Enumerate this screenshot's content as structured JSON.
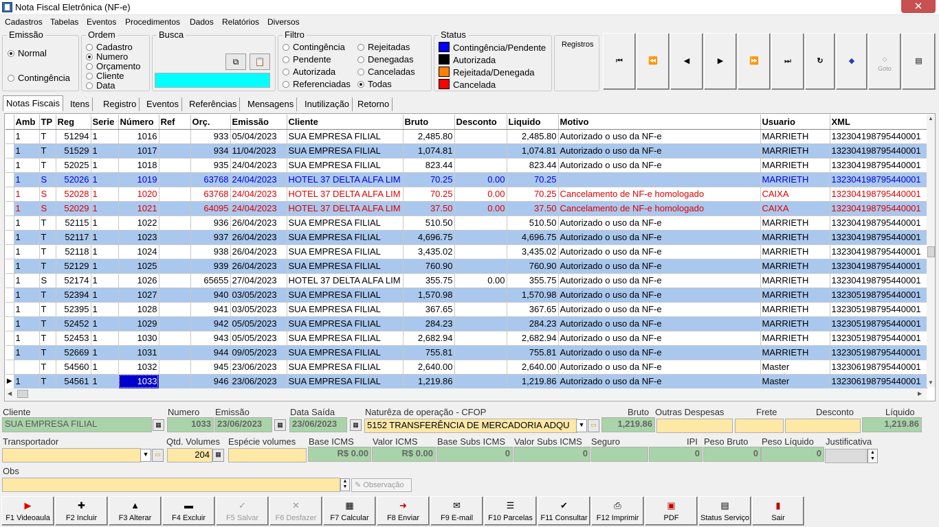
{
  "window": {
    "title": "Nota Fiscal Eletrônica (NF-e)",
    "close": "✕"
  },
  "menu": [
    "Cadastros",
    "Tabelas",
    "Eventos",
    "Procedimentos",
    "Dados",
    "Relatórios",
    "Diversos"
  ],
  "emissao": {
    "label": "Emissão",
    "options": [
      "Normal",
      "Contingência"
    ],
    "selected": "Normal"
  },
  "ordem": {
    "label": "Ordem",
    "options": [
      "Cadastro",
      "Numero",
      "Orçamento",
      "Cliente",
      "Data"
    ],
    "selected": "Numero"
  },
  "busca": {
    "label": "Busca",
    "value": ""
  },
  "filtro": {
    "label": "Filtro",
    "left": [
      "Contingência",
      "Pendente",
      "Autorizada",
      "Referenciadas"
    ],
    "right": [
      "Rejeitadas",
      "Denegadas",
      "Canceladas",
      "Todas"
    ],
    "selected": "Todas"
  },
  "status": {
    "label": "Status",
    "items": [
      {
        "label": "Contingência/Pendente",
        "color": "#0000ff"
      },
      {
        "label": "Autorizada",
        "color": "#000000"
      },
      {
        "label": "Rejeitada/Denegada",
        "color": "#ff8000"
      },
      {
        "label": "Cancelada",
        "color": "#ff0000"
      }
    ]
  },
  "registros": {
    "label": "Registros"
  },
  "nav_icons": [
    "first-icon",
    "prev-page-icon",
    "prev-icon",
    "next-icon",
    "next-page-icon",
    "last-icon",
    "refresh-icon",
    "tag-icon",
    "goto-icon",
    "grid-icon"
  ],
  "nav_goto_label": "Goto",
  "tabs": [
    "Notas Fiscais",
    "Itens",
    "Registro",
    "Eventos",
    "Referências",
    "Mensagens",
    "Inutilização",
    "Retorno"
  ],
  "grid": {
    "columns": [
      "Amb",
      "TP",
      "Reg",
      "Serie",
      "Número",
      "Ref",
      "Orç.",
      "Emissão",
      "Cliente",
      "Bruto",
      "Desconto",
      "Liquido",
      "Motivo",
      "Usuario",
      "XML"
    ],
    "rows": [
      {
        "amb": "1",
        "tp": "T",
        "reg": "51294",
        "serie": "1",
        "numero": "1016",
        "ref": "",
        "orc": "933",
        "emissao": "05/04/2023",
        "cliente": "SUA EMPRESA FILIAL",
        "bruto": "2,485.80",
        "desconto": "",
        "liquido": "2,485.80",
        "motivo": "Autorizado o uso da NF-e",
        "usuario": "MARRIETH",
        "xml": "132304198795440001",
        "style": ""
      },
      {
        "amb": "1",
        "tp": "T",
        "reg": "51529",
        "serie": "1",
        "numero": "1017",
        "ref": "",
        "orc": "934",
        "emissao": "11/04/2023",
        "cliente": "SUA EMPRESA FILIAL",
        "bruto": "1,074.81",
        "desconto": "",
        "liquido": "1,074.81",
        "motivo": "Autorizado o uso da NF-e",
        "usuario": "MARRIETH",
        "xml": "132304198795440001",
        "style": "alt"
      },
      {
        "amb": "1",
        "tp": "T",
        "reg": "52025",
        "serie": "1",
        "numero": "1018",
        "ref": "",
        "orc": "935",
        "emissao": "24/04/2023",
        "cliente": "SUA EMPRESA FILIAL",
        "bruto": "823.44",
        "desconto": "",
        "liquido": "823.44",
        "motivo": "Autorizado o uso da NF-e",
        "usuario": "MARRIETH",
        "xml": "132304198795440001",
        "style": ""
      },
      {
        "amb": "1",
        "tp": "S",
        "reg": "52026",
        "serie": "1",
        "numero": "1019",
        "ref": "",
        "orc": "63768",
        "emissao": "24/04/2023",
        "cliente": "HOTEL 37 DELTA ALFA LIM",
        "bruto": "70.25",
        "desconto": "0.00",
        "liquido": "70.25",
        "motivo": "",
        "usuario": "MARRIETH",
        "xml": "132304198795440001",
        "style": "alt blue"
      },
      {
        "amb": "1",
        "tp": "S",
        "reg": "52028",
        "serie": "1",
        "numero": "1020",
        "ref": "",
        "orc": "63768",
        "emissao": "24/04/2023",
        "cliente": "HOTEL 37 DELTA ALFA LIM",
        "bruto": "70.25",
        "desconto": "0.00",
        "liquido": "70.25",
        "motivo": "Cancelamento de NF-e homologado",
        "usuario": "CAIXA",
        "xml": "132304198795440001",
        "style": "red"
      },
      {
        "amb": "1",
        "tp": "S",
        "reg": "52029",
        "serie": "1",
        "numero": "1021",
        "ref": "",
        "orc": "64095",
        "emissao": "24/04/2023",
        "cliente": "HOTEL 37 DELTA ALFA LIM",
        "bruto": "37.50",
        "desconto": "0.00",
        "liquido": "37.50",
        "motivo": "Cancelamento de NF-e homologado",
        "usuario": "CAIXA",
        "xml": "132304198795440001",
        "style": "alt red"
      },
      {
        "amb": "1",
        "tp": "T",
        "reg": "52115",
        "serie": "1",
        "numero": "1022",
        "ref": "",
        "orc": "936",
        "emissao": "26/04/2023",
        "cliente": "SUA EMPRESA FILIAL",
        "bruto": "510.50",
        "desconto": "",
        "liquido": "510.50",
        "motivo": "Autorizado o uso da NF-e",
        "usuario": "MARRIETH",
        "xml": "132304198795440001",
        "style": ""
      },
      {
        "amb": "1",
        "tp": "T",
        "reg": "52117",
        "serie": "1",
        "numero": "1023",
        "ref": "",
        "orc": "937",
        "emissao": "26/04/2023",
        "cliente": "SUA EMPRESA FILIAL",
        "bruto": "4,696.75",
        "desconto": "",
        "liquido": "4,696.75",
        "motivo": "Autorizado o uso da NF-e",
        "usuario": "MARRIETH",
        "xml": "132304198795440001",
        "style": "alt"
      },
      {
        "amb": "1",
        "tp": "T",
        "reg": "52118",
        "serie": "1",
        "numero": "1024",
        "ref": "",
        "orc": "938",
        "emissao": "26/04/2023",
        "cliente": "SUA EMPRESA FILIAL",
        "bruto": "3,435.02",
        "desconto": "",
        "liquido": "3,435.02",
        "motivo": "Autorizado o uso da NF-e",
        "usuario": "MARRIETH",
        "xml": "132304198795440001",
        "style": ""
      },
      {
        "amb": "1",
        "tp": "T",
        "reg": "52129",
        "serie": "1",
        "numero": "1025",
        "ref": "",
        "orc": "939",
        "emissao": "26/04/2023",
        "cliente": "SUA EMPRESA FILIAL",
        "bruto": "760.90",
        "desconto": "",
        "liquido": "760.90",
        "motivo": "Autorizado o uso da NF-e",
        "usuario": "MARRIETH",
        "xml": "132304198795440001",
        "style": "alt"
      },
      {
        "amb": "1",
        "tp": "S",
        "reg": "52174",
        "serie": "1",
        "numero": "1026",
        "ref": "",
        "orc": "65655",
        "emissao": "27/04/2023",
        "cliente": "HOTEL 37 DELTA ALFA LIM",
        "bruto": "355.75",
        "desconto": "0.00",
        "liquido": "355.75",
        "motivo": "Autorizado o uso da NF-e",
        "usuario": "MARRIETH",
        "xml": "132304198795440001",
        "style": ""
      },
      {
        "amb": "1",
        "tp": "T",
        "reg": "52394",
        "serie": "1",
        "numero": "1027",
        "ref": "",
        "orc": "940",
        "emissao": "03/05/2023",
        "cliente": "SUA EMPRESA FILIAL",
        "bruto": "1,570.98",
        "desconto": "",
        "liquido": "1,570.98",
        "motivo": "Autorizado o uso da NF-e",
        "usuario": "MARRIETH",
        "xml": "132305198795440001",
        "style": "alt"
      },
      {
        "amb": "1",
        "tp": "T",
        "reg": "52395",
        "serie": "1",
        "numero": "1028",
        "ref": "",
        "orc": "941",
        "emissao": "03/05/2023",
        "cliente": "SUA EMPRESA FILIAL",
        "bruto": "367.65",
        "desconto": "",
        "liquido": "367.65",
        "motivo": "Autorizado o uso da NF-e",
        "usuario": "MARRIETH",
        "xml": "132305198795440001",
        "style": ""
      },
      {
        "amb": "1",
        "tp": "T",
        "reg": "52452",
        "serie": "1",
        "numero": "1029",
        "ref": "",
        "orc": "942",
        "emissao": "05/05/2023",
        "cliente": "SUA EMPRESA FILIAL",
        "bruto": "284.23",
        "desconto": "",
        "liquido": "284.23",
        "motivo": "Autorizado o uso da NF-e",
        "usuario": "MARRIETH",
        "xml": "132305198795440001",
        "style": "alt"
      },
      {
        "amb": "1",
        "tp": "T",
        "reg": "52453",
        "serie": "1",
        "numero": "1030",
        "ref": "",
        "orc": "943",
        "emissao": "05/05/2023",
        "cliente": "SUA EMPRESA FILIAL",
        "bruto": "2,682.94",
        "desconto": "",
        "liquido": "2,682.94",
        "motivo": "Autorizado o uso da NF-e",
        "usuario": "MARRIETH",
        "xml": "132305198795440001",
        "style": ""
      },
      {
        "amb": "1",
        "tp": "T",
        "reg": "52669",
        "serie": "1",
        "numero": "1031",
        "ref": "",
        "orc": "944",
        "emissao": "09/05/2023",
        "cliente": "SUA EMPRESA FILIAL",
        "bruto": "755.81",
        "desconto": "",
        "liquido": "755.81",
        "motivo": "Autorizado o uso da NF-e",
        "usuario": "MARRIETH",
        "xml": "132305198795440001",
        "style": "alt"
      },
      {
        "amb": "",
        "tp": "T",
        "reg": "54560",
        "serie": "1",
        "numero": "1032",
        "ref": "",
        "orc": "945",
        "emissao": "23/06/2023",
        "cliente": "SUA EMPRESA FILIAL",
        "bruto": "2,640.00",
        "desconto": "",
        "liquido": "2,640.00",
        "motivo": "Autorizado o uso da NF-e",
        "usuario": "Master",
        "xml": "132306198795440001",
        "style": ""
      },
      {
        "amb": "1",
        "tp": "T",
        "reg": "54561",
        "serie": "1",
        "numero": "1033",
        "ref": "",
        "orc": "946",
        "emissao": "23/06/2023",
        "cliente": "SUA EMPRESA FILIAL",
        "bruto": "1,219.86",
        "desconto": "",
        "liquido": "1,219.86",
        "motivo": "Autorizado o uso da NF-e",
        "usuario": "Master",
        "xml": "132306198795440001",
        "style": "alt current"
      }
    ]
  },
  "detail": {
    "cliente_label": "Cliente",
    "cliente": "SUA EMPRESA FILIAL",
    "numero_label": "Numero",
    "numero": "1033",
    "emissao_label": "Emissão",
    "emissao": "23/06/2023",
    "data_saida_label": "Data Saída",
    "data_saida": "23/06/2023",
    "natureza_label": "Naturêza de operação - CFOP",
    "natureza": "5152 TRANSFERÊNCIA DE MERCADORIA ADQU",
    "bruto_label": "Bruto",
    "bruto": "1,219.86",
    "outras_label": "Outras Despesas",
    "outras": "",
    "frete_label": "Frete",
    "frete": "",
    "desconto_label": "Desconto",
    "desconto": "",
    "liquido_label": "Líquido",
    "liquido": "1,219.86",
    "transportador_label": "Transportador",
    "transportador": "",
    "qtd_volumes_label": "Qtd. Volumes",
    "qtd_volumes": "204",
    "especie_label": "Espécie volumes",
    "especie": "",
    "base_icms_label": "Base ICMS",
    "base_icms": "R$ 0.00",
    "valor_icms_label": "Valor ICMS",
    "valor_icms": "R$ 0.00",
    "base_subs_label": "Base Subs ICMS",
    "base_subs": "0",
    "valor_subs_label": "Valor Subs ICMS",
    "valor_subs": "0",
    "seguro_label": "Seguro",
    "seguro": "",
    "ipi_label": "IPI",
    "ipi": "0",
    "peso_bruto_label": "Peso Bruto",
    "peso_bruto": "0",
    "peso_liquido_label": "Peso Líquido",
    "peso_liquido": "0",
    "justificativa_label": "Justificativa",
    "justificativa": "",
    "obs_label": "Obs",
    "obs": "",
    "observacao_btn": "Observação"
  },
  "footer_buttons": [
    {
      "label": "F1 Videoaula",
      "icon": "▶",
      "enabled": true,
      "name": "videoaula-button",
      "icon_name": "youtube-icon"
    },
    {
      "label": "F2 Incluir",
      "icon": "✚",
      "enabled": true,
      "name": "incluir-button",
      "icon_name": "plus-icon"
    },
    {
      "label": "F3 Alterar",
      "icon": "▲",
      "enabled": true,
      "name": "alterar-button",
      "icon_name": "up-arrow-icon"
    },
    {
      "label": "F4 Excluir",
      "icon": "▬",
      "enabled": true,
      "name": "excluir-button",
      "icon_name": "minus-icon"
    },
    {
      "label": "F5 Salvar",
      "icon": "✓",
      "enabled": false,
      "name": "salvar-button",
      "icon_name": "check-icon"
    },
    {
      "label": "F6 Desfazer",
      "icon": "✕",
      "enabled": false,
      "name": "desfazer-button",
      "icon_name": "x-icon"
    },
    {
      "label": "F7 Calcular",
      "icon": "▦",
      "enabled": true,
      "name": "calcular-button",
      "icon_name": "calculator-icon"
    },
    {
      "label": "F8 Enviar",
      "icon": "➜",
      "enabled": true,
      "name": "enviar-button",
      "icon_name": "send-icon"
    },
    {
      "label": "F9 E-mail",
      "icon": "✉",
      "enabled": true,
      "name": "email-button",
      "icon_name": "envelope-icon"
    },
    {
      "label": "F10 Parcelas",
      "icon": "☰",
      "enabled": true,
      "name": "parcelas-button",
      "icon_name": "list-icon"
    },
    {
      "label": "F11 Consultar",
      "icon": "✔",
      "enabled": true,
      "name": "consultar-button",
      "icon_name": "check-document-icon"
    },
    {
      "label": "F12 Imprimir",
      "icon": "⎙",
      "enabled": true,
      "name": "imprimir-button",
      "icon_name": "printer-icon"
    },
    {
      "label": "PDF",
      "icon": "▣",
      "enabled": true,
      "name": "pdf-button",
      "icon_name": "pdf-icon"
    },
    {
      "label": "Status Serviço",
      "icon": "▤",
      "enabled": true,
      "name": "status-servico-button",
      "icon_name": "server-icon"
    },
    {
      "label": "Sair",
      "icon": "▮",
      "enabled": true,
      "name": "sair-button",
      "icon_name": "exit-door-icon"
    }
  ],
  "colors": {
    "row_alt": "#aac8ee",
    "selection": "#0000cc",
    "readonly_field": "#a9d4a9",
    "editable_field": "#fde8a6",
    "busca_field": "#00ffff"
  }
}
